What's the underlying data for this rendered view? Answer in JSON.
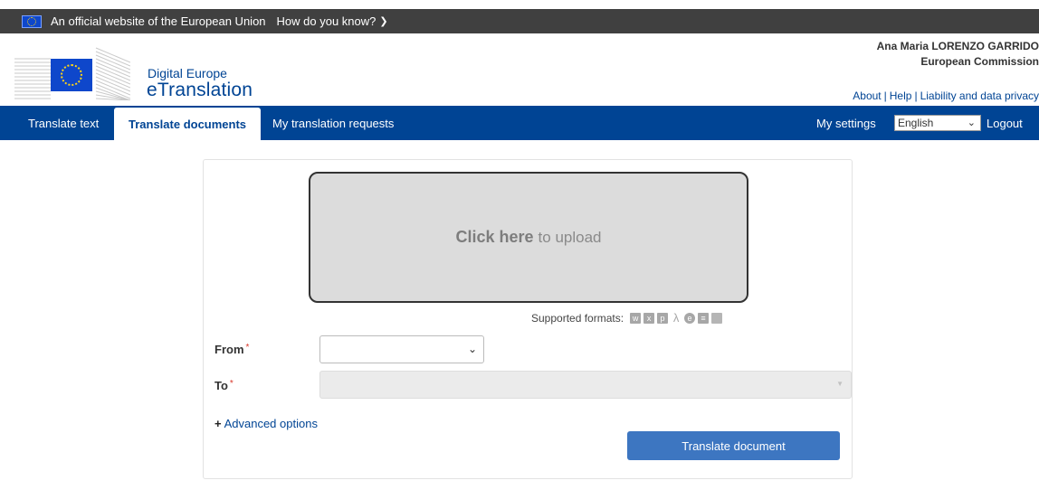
{
  "eu_bar": {
    "official_text": "An official website of the European Union",
    "how_know": "How do you know?"
  },
  "header": {
    "brand_sub": "Digital Europe",
    "brand_main": "eTranslation",
    "user_name": "Ana Maria LORENZO GARRIDO",
    "user_org": "European Commission",
    "links": {
      "about": "About",
      "help": "Help",
      "liability": "Liability and data privacy"
    }
  },
  "nav": {
    "tabs": [
      {
        "label": "Translate text"
      },
      {
        "label": "Translate documents"
      },
      {
        "label": "My translation requests"
      }
    ],
    "settings": "My settings",
    "language_selected": "English",
    "logout": "Logout"
  },
  "upload": {
    "click_here": "Click here",
    "to_upload": "to upload",
    "supported_formats_label": "Supported formats:",
    "formats": [
      "word-icon",
      "excel-icon",
      "powerpoint-icon",
      "pdf-icon",
      "html-icon",
      "text-icon",
      "file-icon"
    ]
  },
  "form": {
    "from_label": "From",
    "to_label": "To",
    "required_mark": "*",
    "advanced_plus": "+",
    "advanced_options": "Advanced options",
    "translate_button": "Translate document"
  },
  "colors": {
    "eu_bar": "#404040",
    "nav_bar": "#004494",
    "brand_blue": "#004494",
    "button": "#3d76c1"
  }
}
